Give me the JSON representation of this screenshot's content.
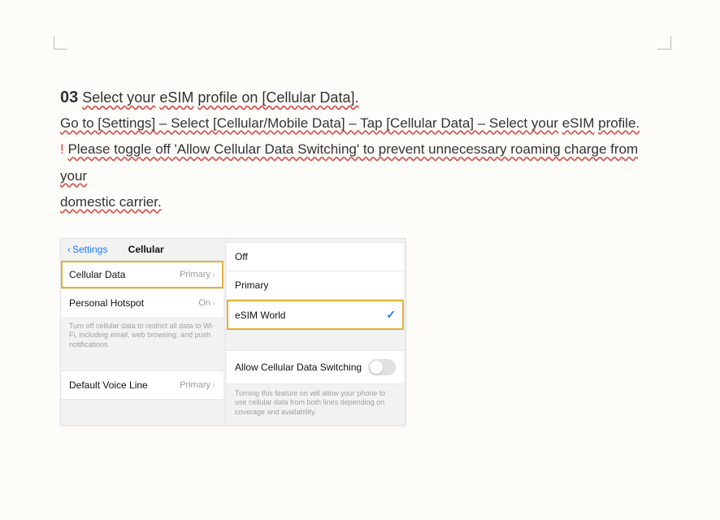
{
  "step": {
    "number": "03",
    "title_parts": {
      "a": "Select your",
      "b": "eSIM",
      "c": "profile on [Cellular Data]."
    }
  },
  "instr": {
    "p1": "Go to [Settings] – Select [Cellular/Mobile Data] – Tap [Cellular Data] – Select your",
    "p1b": "eSIM",
    "p1c": "profile.",
    "warn_prefix": "!",
    "p2a": "Please toggle off 'Allow Cellular Data Switching' to prevent unnecessary roaming charge from your",
    "p2b": "domestic carrier."
  },
  "paneA": {
    "back": "Settings",
    "title": "Cellular",
    "rows": {
      "cellular_data": {
        "label": "Cellular Data",
        "value": "Primary"
      },
      "hotspot": {
        "label": "Personal Hotspot",
        "value": "On"
      },
      "note": "Turn off cellular data to restrict all data to Wi-Fi, including email, web browsing, and push notifications.",
      "default_voice": {
        "label": "Default Voice Line",
        "value": "Primary"
      }
    }
  },
  "paneB": {
    "rows": {
      "off": "Off",
      "primary": "Primary",
      "esim": "eSIM World",
      "switching_label": "Allow Cellular Data Switching",
      "switching_note": "Turning this feature on will allow your phone to use cellular data from both lines depending on coverage and availability."
    }
  }
}
